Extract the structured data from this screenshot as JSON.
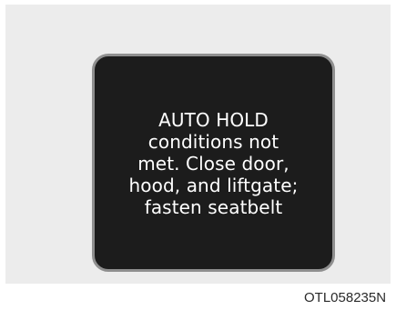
{
  "message": {
    "lines": [
      "AUTO HOLD",
      "conditions not",
      "met. Close door,",
      "hood, and liftgate;",
      "fasten seatbelt"
    ]
  },
  "figure_code": "OTL058235N",
  "colors": {
    "page_background": "#ececec",
    "display_background": "#1c1c1c",
    "display_border": "#8f8f8f",
    "text": "#ffffff"
  }
}
